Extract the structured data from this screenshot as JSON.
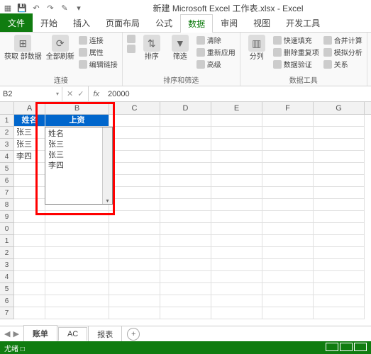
{
  "titlebar": {
    "title": "新建 Microsoft Excel 工作表.xlsx - Excel"
  },
  "tabs": {
    "file": "文件",
    "items": [
      "开始",
      "插入",
      "页面布局",
      "公式",
      "数据",
      "审阅",
      "视图",
      "开发工具"
    ],
    "active": "数据"
  },
  "ribbon": {
    "g1": {
      "btn1": "获取\n部数据",
      "btn2": "全部刷新",
      "s1": "连接",
      "s2": "属性",
      "s3": "编辑链接",
      "label": "连接"
    },
    "g2": {
      "sortAZ": "A→Z",
      "sortZA": "Z→A",
      "sort": "排序",
      "filter": "筛选",
      "s1": "清除",
      "s2": "重新应用",
      "s3": "高级",
      "label": "排序和筛选"
    },
    "g3": {
      "btn": "分列",
      "s1": "快速填充",
      "s2": "删除重复项",
      "s3": "数据验证",
      "s4": "合并计算",
      "s5": "模拟分析",
      "s6": "关系",
      "label": "数据工具"
    }
  },
  "formula": {
    "cellref": "B2",
    "value": "20000"
  },
  "cols": [
    "A",
    "B",
    "C",
    "D",
    "E",
    "F",
    "G"
  ],
  "headerRow": {
    "A": "姓名",
    "B": "上资"
  },
  "dataRows": [
    {
      "A": "张三",
      "B": "20000"
    },
    {
      "A": "张三",
      "B": ""
    },
    {
      "A": "李四",
      "B": ""
    }
  ],
  "rowNums": [
    "1",
    "2",
    "3",
    "4",
    "5",
    "6",
    "7",
    "8",
    "9",
    "0",
    "1",
    "2",
    "3",
    "4",
    "5",
    "6",
    "7"
  ],
  "dropdown": {
    "options": [
      "姓名",
      "张三",
      "张三",
      "李四"
    ]
  },
  "sheets": {
    "active": "账单",
    "items": [
      "账单",
      "AC",
      "报表"
    ]
  },
  "status": {
    "left": "尤绪",
    "recording": "□"
  }
}
